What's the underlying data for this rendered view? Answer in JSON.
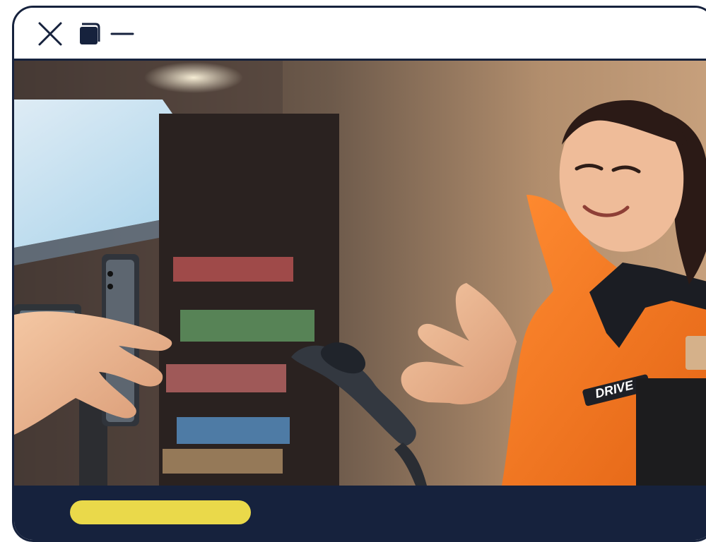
{
  "window": {
    "controls": [
      {
        "name": "close",
        "icon": "close-icon"
      },
      {
        "name": "maximize",
        "icon": "window-icon"
      },
      {
        "name": "minimize",
        "icon": "minimize-icon"
      }
    ]
  },
  "photo": {
    "shirt_logo_text": "DRIVE",
    "subject": "cashier-scanning-phone-photo"
  },
  "footer": {
    "button_label": ""
  },
  "colors": {
    "frame": "#16223d",
    "footer": "#16223d",
    "accent": "#ead94a",
    "shirt": "#f2781f"
  }
}
